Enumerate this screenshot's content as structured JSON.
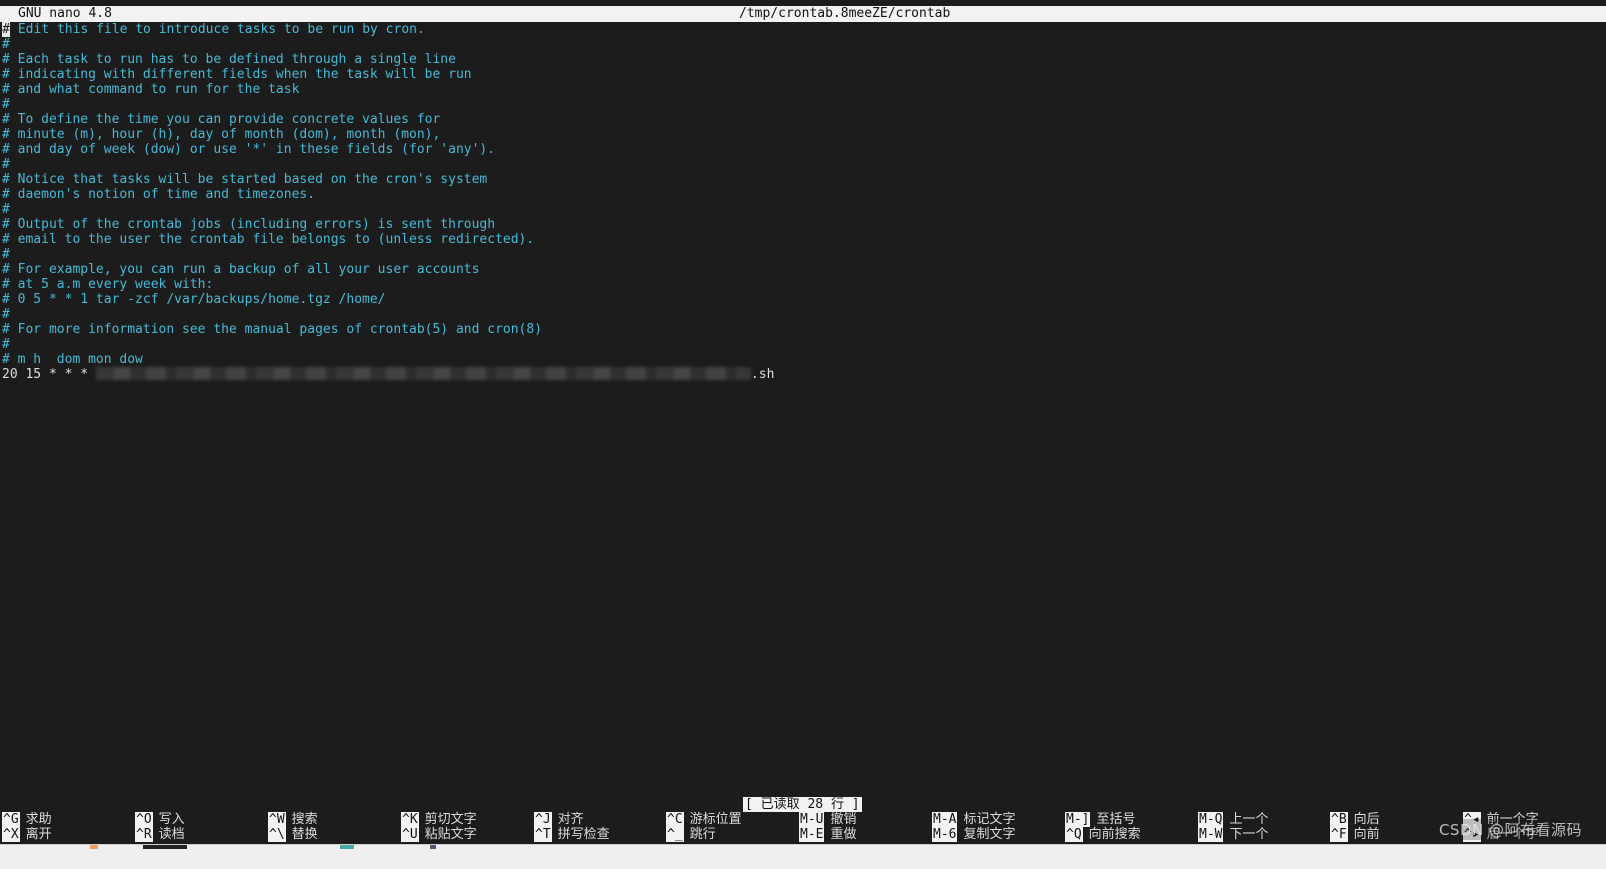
{
  "titlebar": {
    "app": "GNU nano 4.8",
    "file": "/tmp/crontab.8meeZE/crontab"
  },
  "editor": {
    "lines": [
      {
        "kind": "comment-cursor",
        "text": " Edit this file to introduce tasks to be run by cron."
      },
      {
        "kind": "comment",
        "text": "#"
      },
      {
        "kind": "comment",
        "text": "# Each task to run has to be defined through a single line"
      },
      {
        "kind": "comment",
        "text": "# indicating with different fields when the task will be run"
      },
      {
        "kind": "comment",
        "text": "# and what command to run for the task"
      },
      {
        "kind": "comment",
        "text": "#"
      },
      {
        "kind": "comment",
        "text": "# To define the time you can provide concrete values for"
      },
      {
        "kind": "comment",
        "text": "# minute (m), hour (h), day of month (dom), month (mon),"
      },
      {
        "kind": "comment",
        "text": "# and day of week (dow) or use '*' in these fields (for 'any')."
      },
      {
        "kind": "comment",
        "text": "#"
      },
      {
        "kind": "comment",
        "text": "# Notice that tasks will be started based on the cron's system"
      },
      {
        "kind": "comment",
        "text": "# daemon's notion of time and timezones."
      },
      {
        "kind": "comment",
        "text": "#"
      },
      {
        "kind": "comment",
        "text": "# Output of the crontab jobs (including errors) is sent through"
      },
      {
        "kind": "comment",
        "text": "# email to the user the crontab file belongs to (unless redirected)."
      },
      {
        "kind": "comment",
        "text": "#"
      },
      {
        "kind": "comment",
        "text": "# For example, you can run a backup of all your user accounts"
      },
      {
        "kind": "comment",
        "text": "# at 5 a.m every week with:"
      },
      {
        "kind": "comment",
        "text": "# 0 5 * * 1 tar -zcf /var/backups/home.tgz /home/"
      },
      {
        "kind": "comment",
        "text": "#"
      },
      {
        "kind": "comment",
        "text": "# For more information see the manual pages of crontab(5) and cron(8)"
      },
      {
        "kind": "comment",
        "text": "#"
      },
      {
        "kind": "comment",
        "text": "# m h  dom mon dow"
      },
      {
        "kind": "command",
        "prefix": "20 15 * * * ",
        "suffix": ".sh"
      }
    ]
  },
  "status": "[ 已读取 28 行 ]",
  "shortcuts": [
    {
      "key": "^G",
      "label": "求助"
    },
    {
      "key": "^X",
      "label": "离开"
    },
    {
      "key": "^O",
      "label": "写入"
    },
    {
      "key": "^R",
      "label": "读档"
    },
    {
      "key": "^W",
      "label": "搜索"
    },
    {
      "key": "^\\",
      "label": "替换"
    },
    {
      "key": "^K",
      "label": "剪切文字"
    },
    {
      "key": "^U",
      "label": "粘贴文字"
    },
    {
      "key": "^J",
      "label": "对齐"
    },
    {
      "key": "^T",
      "label": "拼写检查"
    },
    {
      "key": "^C",
      "label": "游标位置"
    },
    {
      "key": "^_",
      "label": "跳行"
    },
    {
      "key": "M-U",
      "label": "撤销"
    },
    {
      "key": "M-E",
      "label": "重做"
    },
    {
      "key": "M-A",
      "label": "标记文字"
    },
    {
      "key": "M-6",
      "label": "复制文字"
    },
    {
      "key": "M-]",
      "label": "至括号"
    },
    {
      "key": "^Q",
      "label": "向前搜索"
    },
    {
      "key": "M-Q",
      "label": "上一个"
    },
    {
      "key": "M-W",
      "label": "下一个"
    },
    {
      "key": "^B",
      "label": "向后"
    },
    {
      "key": "^F",
      "label": "向前"
    },
    {
      "key": "^◂",
      "label": "前一个字"
    },
    {
      "key": "^▸",
      "label": "后一个字"
    }
  ],
  "watermark": "CSDN @阿布看源码"
}
